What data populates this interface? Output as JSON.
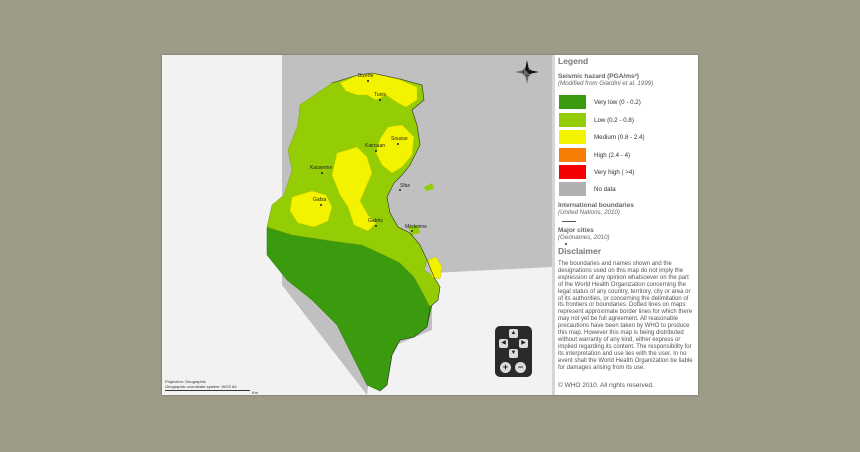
{
  "map": {
    "background_color": "#c0c0c0",
    "cities": [
      {
        "name": "Bizerte"
      },
      {
        "name": "Tunis"
      },
      {
        "name": "Sousse"
      },
      {
        "name": "Kairouan"
      },
      {
        "name": "Kasserine"
      },
      {
        "name": "Sfax"
      },
      {
        "name": "Gafsa"
      },
      {
        "name": "Gabès"
      },
      {
        "name": "Médenine"
      }
    ],
    "projection_lines": [
      "Projection: Geographic",
      "Geographic coordinate system: WGS 84"
    ],
    "scale_label": "Km",
    "compass_icon": "north-arrow-icon",
    "nav_icons": [
      "pan-up-icon",
      "pan-left-icon",
      "pan-right-icon",
      "pan-down-icon",
      "zoom-in-icon",
      "zoom-out-icon"
    ]
  },
  "legend": {
    "title": "Legend",
    "hazard_title": "Seismic hazard (PGA/ms²)",
    "hazard_source": "(Modified from Giardini et al. 1999)",
    "classes": [
      {
        "label": "Very low  (0 - 0.2)",
        "color": "#3a9b0f"
      },
      {
        "label": "Low (0.2 - 0.8)",
        "color": "#95cd04"
      },
      {
        "label": "Medium (0.8 - 2.4)",
        "color": "#f3f300"
      },
      {
        "label": "High  (2.4 - 4)",
        "color": "#f77c06"
      },
      {
        "label": "Very high  ( >4)",
        "color": "#f50000"
      },
      {
        "label": "No data",
        "color": "#b0b0b0"
      }
    ],
    "boundaries_title": "International boundaries",
    "boundaries_source": "(United Nations, 2010)",
    "cities_title": "Major cities",
    "cities_source": "(Geonames, 2010)",
    "disclaimer_title": "Disclaimer",
    "disclaimer_text": "The boundaries and names shown and the designations used on this map do not imply the expression of any opinion whatsoever on the part of the World Health Organization concerning the legal status of any country, territory, city or area or of its authorities, or concerning the delimitation of its frontiers or boundaries. Dotted lines on maps represent approximate border lines for which there may not yet be full agreement. All reasonable precautions have been taken by WHO to produce this map. However this map is being distributed without warranty of any kind, either express or implied regarding its content. The responsibility for its interpretation and use lies with the user. In no event shall the World Health Organization be liable for damages arising from its use.",
    "copyright": "© WHO 2010. All rights reserved."
  }
}
